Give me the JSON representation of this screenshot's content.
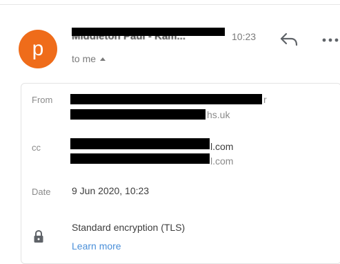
{
  "header": {
    "avatar_letter": "p",
    "sender_name": "Middleton Paul - Kam...",
    "time": "10:23",
    "recipient": "to me"
  },
  "details": {
    "from_label": "From",
    "from_line2_visible_suffix": "hs.uk",
    "from_line1_visible_suffix": "r",
    "cc_label": "cc",
    "cc_line1_visible_suffix": "l.com",
    "cc_line2_visible_suffix": "l.com",
    "date_label": "Date",
    "date_value": "9 Jun 2020, 10:23",
    "encryption_value": "Standard encryption (TLS)",
    "learn_more": "Learn more"
  },
  "colors": {
    "avatar_bg": "#ef6c1a",
    "link": "#4a8fd9",
    "muted": "#8a8a8a"
  }
}
